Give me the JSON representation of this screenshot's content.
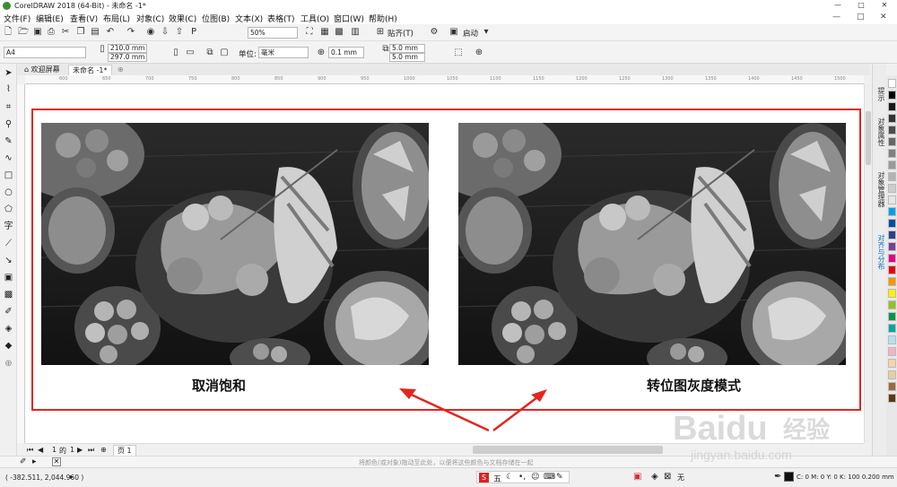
{
  "app": {
    "title": "CorelDRAW 2018 (64-Bit) - 未命名 -1*"
  },
  "window": {
    "minimize": "—",
    "restore": "□",
    "close": "✕"
  },
  "menu": {
    "items": [
      "文件(F)",
      "编辑(E)",
      "查看(V)",
      "布局(L)",
      "对象(C)",
      "效果(C)",
      "位图(B)",
      "文本(X)",
      "表格(T)",
      "工具(O)",
      "窗口(W)",
      "帮助(H)"
    ],
    "controls": [
      "—",
      "□",
      "✕"
    ]
  },
  "standard_toolbar": {
    "zoom": "50%",
    "snap_label": "贴齐(T)",
    "launch_label": "启动"
  },
  "property_bar": {
    "page_size": "A4",
    "width": "210.0 mm",
    "height": "297.0 mm",
    "unit_label": "单位:",
    "unit": "毫米",
    "nudge": "0.1 mm",
    "dup_x": "5.0 mm",
    "dup_y": "5.0 mm"
  },
  "tabs": [
    {
      "label": "欢迎屏幕"
    },
    {
      "label": "未命名 -1*"
    }
  ],
  "ruler": {
    "ticks": [
      "600",
      "650",
      "700",
      "750",
      "800",
      "850",
      "900",
      "950",
      "1000",
      "1050",
      "1100",
      "1150",
      "1200",
      "1250",
      "1300",
      "1350",
      "1400",
      "1450",
      "1500"
    ]
  },
  "canvas": {
    "left_caption": "取消饱和",
    "right_caption": "转位图灰度模式"
  },
  "dockers": [
    {
      "label": "提示"
    },
    {
      "label": "对象属性"
    },
    {
      "label": "对象管理器"
    },
    {
      "label": "对齐与分布"
    }
  ],
  "palette": {
    "colors": [
      "#ffffff",
      "#000000",
      "#1a1a1a",
      "#333333",
      "#4d4d4d",
      "#666666",
      "#808080",
      "#999999",
      "#b3b3b3",
      "#cccccc",
      "#e6e6e6",
      "#00a0e9",
      "#0050a0",
      "#2d3e8c",
      "#7a3e9c",
      "#e4007f",
      "#e60012",
      "#f39800",
      "#fff100",
      "#8fc31f",
      "#009944",
      "#00a7a0",
      "#b5e1f0",
      "#f5b2c5",
      "#f9d2a8",
      "#e0d0a8",
      "#9c6a3c",
      "#603813"
    ]
  },
  "page_nav": {
    "current": "1",
    "separator": "的",
    "total": "1",
    "page_tab": "页 1"
  },
  "palette_hint": "将颜色(或对象)拖动至此处，以便将这些颜色与文档存储在一起",
  "status": {
    "coords": "( -382.511, 2,044.960 )",
    "fill_none": "无",
    "outline": "C: 0 M: 0 Y: 0 K: 100  0.200 mm"
  },
  "watermark": {
    "brand": "Baidu",
    "brand_cn": "经验",
    "url": "jingyan.baidu.com"
  }
}
